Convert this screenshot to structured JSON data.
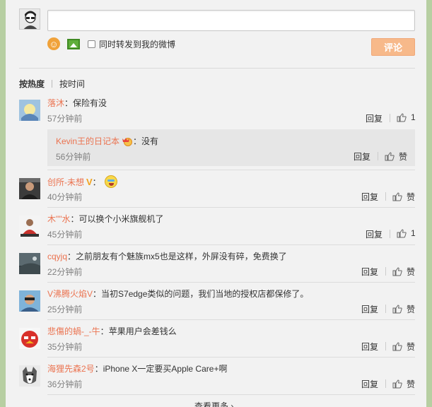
{
  "composer": {
    "input_value": "",
    "repost_label": "同时转发到我的微博",
    "submit_label": "评论"
  },
  "sort": {
    "hot_label": "按热度",
    "time_label": "按时间"
  },
  "comments": [
    {
      "name": "落沐",
      "text": "保险有没",
      "time": "57分钟前",
      "reply": "回复",
      "likes": "1"
    },
    {
      "name": "Kevin王的日记本",
      "text": "没有",
      "time": "56分钟前",
      "reply": "回复",
      "likes": "赞"
    },
    {
      "name": "创所-未想",
      "text": "",
      "time": "40分钟前",
      "reply": "回复",
      "likes": "赞"
    },
    {
      "name": "木\"\"水",
      "text": "可以换个小米旗舰机了",
      "time": "45分钟前",
      "reply": "回复",
      "likes": "1"
    },
    {
      "name": "cqyjq",
      "text": "之前朋友有个魅族mx5也是这样，外屏没有碎，免费换了",
      "time": "22分钟前",
      "reply": "回复",
      "likes": "赞"
    },
    {
      "name": "V沸腾火焰V",
      "text": "当初S7edge类似的问题，我们当地的授权店都保修了。",
      "time": "25分钟前",
      "reply": "回复",
      "likes": "赞"
    },
    {
      "name": "悲傷的蝸-_-牛",
      "text": "苹果用户会差钱么",
      "time": "35分钟前",
      "reply": "回复",
      "likes": "赞"
    },
    {
      "name": "海狸先森2号",
      "text": "iPhone X一定要买Apple Care+啊",
      "time": "36分钟前",
      "reply": "回复",
      "likes": "赞"
    }
  ],
  "separator": "：",
  "more_label": "查看更多 ›",
  "colors": {
    "name": "#eb7350",
    "submit_bg": "#f7b98a",
    "background": "#b7cfa2"
  }
}
